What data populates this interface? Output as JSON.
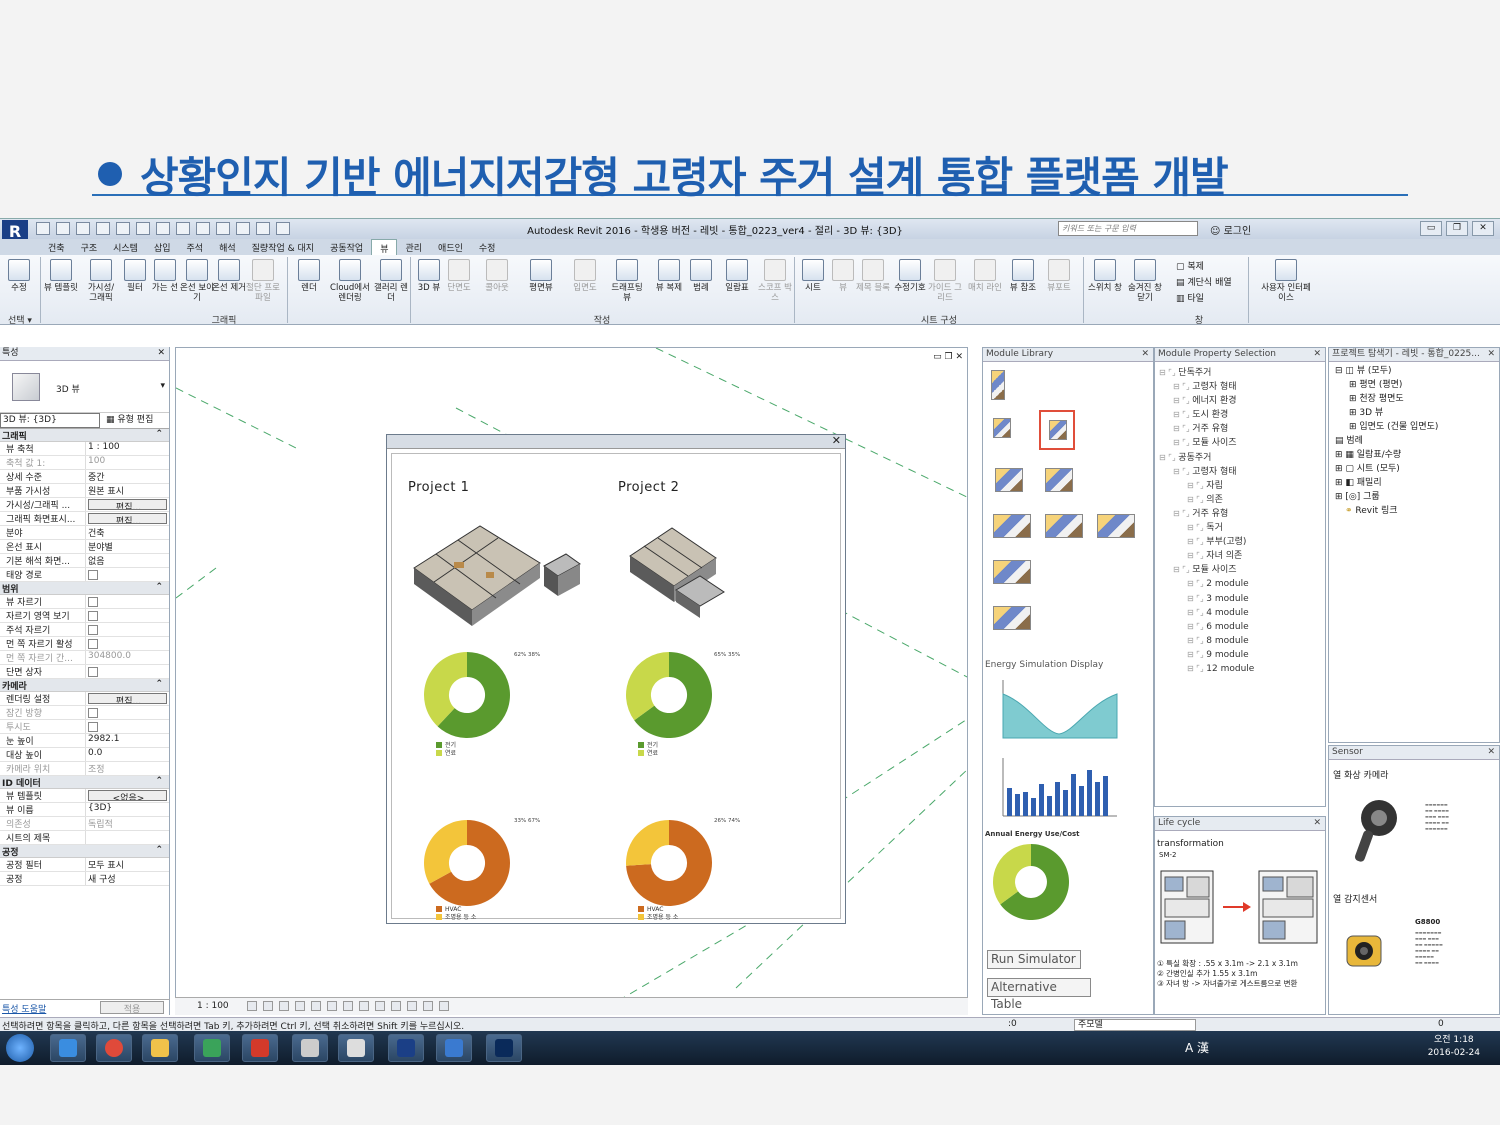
{
  "slide": {
    "title": "상황인지 기반 에너지저감형 고령자 주거 설계 통합 플랫폼 개발"
  },
  "window": {
    "title": "Autodesk Revit 2016 - 학생용 버전 -    레빗 - 통합_0223_ver4 - 절리 - 3D 뷰: {3D}",
    "search_placeholder": "키워드 또는 구문 입력",
    "login": "로그인"
  },
  "ribbon_tabs": [
    "건축",
    "구조",
    "시스템",
    "삽입",
    "주석",
    "해석",
    "질량작업 & 대지",
    "공동작업",
    "뷰",
    "관리",
    "애드인",
    "수정"
  ],
  "active_tab": "뷰",
  "ribbon": {
    "select": "수정",
    "select_panel": "선택 ▾",
    "graphics": [
      "뷰 템플릿",
      "가시성/ 그래픽",
      "필터",
      "가는 선",
      "온선 보이기",
      "온선 제거",
      "절단 프로파일"
    ],
    "graphics_panel": "그래픽",
    "render": [
      "렌더",
      "Cloud에서 렌더링",
      "갤러리 렌더"
    ],
    "create": [
      "3D 뷰",
      "단면도",
      "콜아웃",
      "평면뷰",
      "입면도",
      "드래프팅 뷰",
      "뷰 복제",
      "범례",
      "일람표",
      "스코프 박스"
    ],
    "create_panel": "작성",
    "sheet": [
      "시트",
      "뷰",
      "제목 블록",
      "수정기호",
      "가이드 그리드",
      "매치 라인",
      "뷰 참조",
      "뷰포트"
    ],
    "sheet_panel": "시트 구성",
    "window": [
      "스위치 창",
      "숨겨진 창 닫기",
      "복제",
      "계단식 배열",
      "타일"
    ],
    "window_panel": "창",
    "ui": "사용자 인터페이스"
  },
  "properties": {
    "header": "특성",
    "type_name": "3D 뷰",
    "view_selector": "3D 뷰: {3D}",
    "edit_type": "유형 편집",
    "sections": [
      {
        "name": "그래픽",
        "rows": [
          {
            "k": "뷰 축척",
            "v": "1 : 100"
          },
          {
            "k": "축척 값    1:",
            "v": "100",
            "dim": true
          },
          {
            "k": "상세 수준",
            "v": "중간"
          },
          {
            "k": "부품 가시성",
            "v": "원본 표시"
          },
          {
            "k": "가시성/그래픽 ...",
            "v": "편집...",
            "btn": true
          },
          {
            "k": "그래픽 화면표시...",
            "v": "편집...",
            "btn": true
          },
          {
            "k": "분야",
            "v": "건축"
          },
          {
            "k": "온선 표시",
            "v": "분야별"
          },
          {
            "k": "기본 해석 화면...",
            "v": "없음"
          },
          {
            "k": "태양 경로",
            "v": "",
            "cb": true
          }
        ]
      },
      {
        "name": "범위",
        "rows": [
          {
            "k": "뷰 자르기",
            "v": "",
            "cb": true
          },
          {
            "k": "자르기 영역 보기",
            "v": "",
            "cb": true
          },
          {
            "k": "주석 자르기",
            "v": "",
            "cb": true
          },
          {
            "k": "먼 쪽 자르기 활성",
            "v": "",
            "cb": true
          },
          {
            "k": "먼 쪽 자르기 간...",
            "v": "304800.0",
            "dim": true
          },
          {
            "k": "단면 상자",
            "v": "",
            "cb": true
          }
        ]
      },
      {
        "name": "카메라",
        "rows": [
          {
            "k": "렌더링 설정",
            "v": "편집...",
            "btn": true
          },
          {
            "k": "잠긴 방향",
            "v": "",
            "cb": true,
            "dim": true
          },
          {
            "k": "투시도",
            "v": "",
            "cb": true,
            "dim": true
          },
          {
            "k": "눈 높이",
            "v": "2982.1"
          },
          {
            "k": "대상 높이",
            "v": "0.0"
          },
          {
            "k": "카메라 위치",
            "v": "조정",
            "dim": true
          }
        ]
      },
      {
        "name": "ID 데이터",
        "rows": [
          {
            "k": "뷰 템플릿",
            "v": "<없음>",
            "btn": true
          },
          {
            "k": "뷰 이름",
            "v": "{3D}"
          },
          {
            "k": "의존성",
            "v": "독립적",
            "dim": true
          },
          {
            "k": "시트의 제목",
            "v": ""
          }
        ]
      },
      {
        "name": "공정",
        "rows": [
          {
            "k": "공정 필터",
            "v": "모두 표시"
          },
          {
            "k": "공정",
            "v": "새 구성"
          }
        ]
      }
    ],
    "help_link": "특성 도움말",
    "apply": "적용"
  },
  "viewport": {
    "scale": "1 : 100",
    "project1": "Project 1",
    "project2": "Project 2",
    "p1_top_pct": "62% 38%",
    "p2_top_pct": "65% 35%",
    "p1_bot_pct": "33% 67%",
    "p2_bot_pct": "26% 74%",
    "legend_top": [
      "전기",
      "연료"
    ],
    "legend_bot": [
      "HVAC",
      "조명용 등 소"
    ]
  },
  "module_library": {
    "header": "Module Library",
    "energy_label": "Energy Simulation Display",
    "annual_label": "Annual Energy Use/Cost",
    "run_button": "Run Simulator",
    "alt_button": "Alternative Table"
  },
  "module_property": {
    "header": "Module Property Selection",
    "tree": [
      "단독주거",
      "고령자 형태",
      "에너지 환경",
      "도시 환경",
      "거주 유형",
      "모듈 사이즈",
      "공동주거",
      "고령자 형태",
      "자립",
      "의존",
      "거주 유형",
      "독거",
      "부부(고령)",
      "자녀 의존",
      "모듈 사이즈",
      "2 module",
      "3 module",
      "4 module",
      "6 module",
      "8 module",
      "9 module",
      "12 module"
    ]
  },
  "life_cycle": {
    "header": "Life cycle",
    "title": "transformation",
    "subtitle": "SM-2",
    "notes": [
      "① 특실 확장 : .55 x 3.1m -> 2.1 x 3.1m",
      "② 간병인실 추가 1.55 x 3.1m",
      "③ 자녀 방 -> 자녀출가로 게스트룸으로 변환"
    ]
  },
  "project_browser": {
    "header": "프로젝트 탐색기 - 레빗 - 통합_0225...",
    "items": [
      "뷰 (모두)",
      "평면 (평면)",
      "천장 평면도",
      "3D 뷰",
      "입면도 (건물 입면도)",
      "범례",
      "일람표/수량",
      "시트 (모두)",
      "패밀리",
      "그룹",
      "Revit 링크"
    ]
  },
  "sensor": {
    "header": "Sensor",
    "item1": "열 화상 카메라",
    "item2": "열 감지센서",
    "product": "G8800"
  },
  "status": {
    "message": "선택하려면 항목을 클릭하고, 다른 항목을 선택하려면 Tab 키, 추가하려면 Ctrl 키, 선택 취소하려면 Shift 키를 누르십시오.",
    "zero": ":0",
    "model": "주모델",
    "zero2": "0"
  },
  "taskbar": {
    "ime": "A 漢",
    "time": "오전 1:18",
    "date": "2016-02-24"
  },
  "chart_data": [
    {
      "type": "pie",
      "title": "Project 1",
      "labels": [
        "전기",
        "연료"
      ],
      "values": [
        62,
        38
      ],
      "colors": [
        "#5a9a2e",
        "#c8d84a"
      ]
    },
    {
      "type": "pie",
      "title": "Project 2",
      "labels": [
        "전기",
        "연료"
      ],
      "values": [
        65,
        35
      ],
      "colors": [
        "#5a9a2e",
        "#c8d84a"
      ]
    },
    {
      "type": "pie",
      "title": "Project 1",
      "labels": [
        "HVAC",
        "조명용 등 소"
      ],
      "values": [
        67,
        33
      ],
      "colors": [
        "#cc6a1f",
        "#f3c53a"
      ]
    },
    {
      "type": "pie",
      "title": "Project 2",
      "labels": [
        "HVAC",
        "조명용 등 소"
      ],
      "values": [
        74,
        26
      ],
      "colors": [
        "#cc6a1f",
        "#f3c53a"
      ]
    }
  ]
}
